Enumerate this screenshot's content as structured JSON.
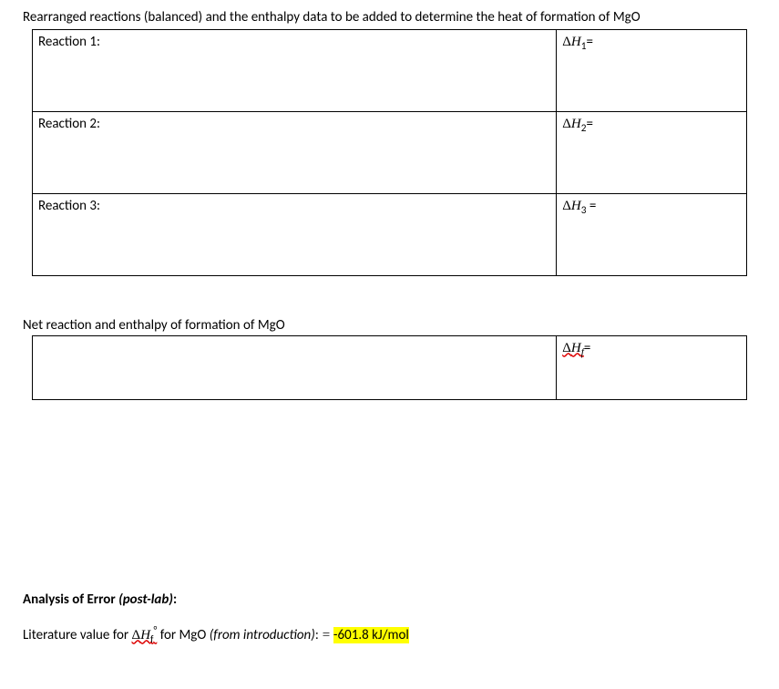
{
  "intro": "Rearranged reactions (balanced) and the enthalpy data to be added to determine the heat of formation of MgO",
  "reactions": [
    {
      "label": "Reaction 1:",
      "dh_num": "1",
      "equals": "="
    },
    {
      "label": "Reaction 2:",
      "dh_num": "2",
      "equals": "="
    },
    {
      "label": "Reaction 3:",
      "dh_num": "3",
      "equals": " ="
    }
  ],
  "net_heading": "Net reaction and enthalpy of formation of MgO",
  "net_dh_sub": "f",
  "net_equals": "=",
  "analysis": {
    "label": "Analysis of Error",
    "postlab": "(post-lab)",
    "colon": ":"
  },
  "lit": {
    "prefix": "Literature value for ",
    "dh_text": "ΔH",
    "sub": "f",
    "sup": "°",
    "mid": " for MgO ",
    "from": "(from introduction)",
    "colon_eq": ": = ",
    "value": "-601.8 kJ/mol"
  }
}
